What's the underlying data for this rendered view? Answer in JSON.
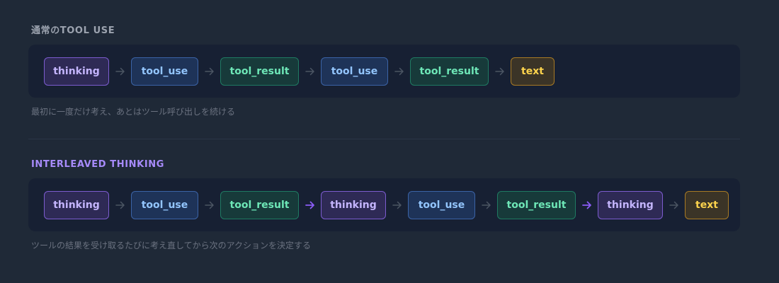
{
  "sections": [
    {
      "title": "通常のTOOL USE",
      "caption": "最初に一度だけ考え、あとはツール呼び出しを続ける",
      "nodes": [
        "thinking",
        "tool_use",
        "tool_result",
        "tool_use",
        "tool_result",
        "text"
      ],
      "arrows": [
        "plain",
        "plain",
        "plain",
        "plain",
        "plain"
      ]
    },
    {
      "title": "INTERLEAVED THINKING",
      "caption": "ツールの結果を受け取るたびに考え直してから次のアクションを決定する",
      "nodes": [
        "thinking",
        "tool_use",
        "tool_result",
        "thinking",
        "tool_use",
        "tool_result",
        "thinking",
        "text"
      ],
      "arrows": [
        "plain",
        "plain",
        "highlight",
        "plain",
        "plain",
        "highlight",
        "plain"
      ]
    }
  ],
  "colors": {
    "background": "#1f2937",
    "panel": "#172033",
    "arrow_plain": "#4b5563",
    "arrow_highlight": "#8b5cf6",
    "thinking": "#c4b5fd",
    "tool_use": "#93c5fd",
    "tool_result": "#6ee7b7",
    "text": "#fcd34d"
  },
  "icons": {
    "arrow": "arrow-right-icon"
  }
}
